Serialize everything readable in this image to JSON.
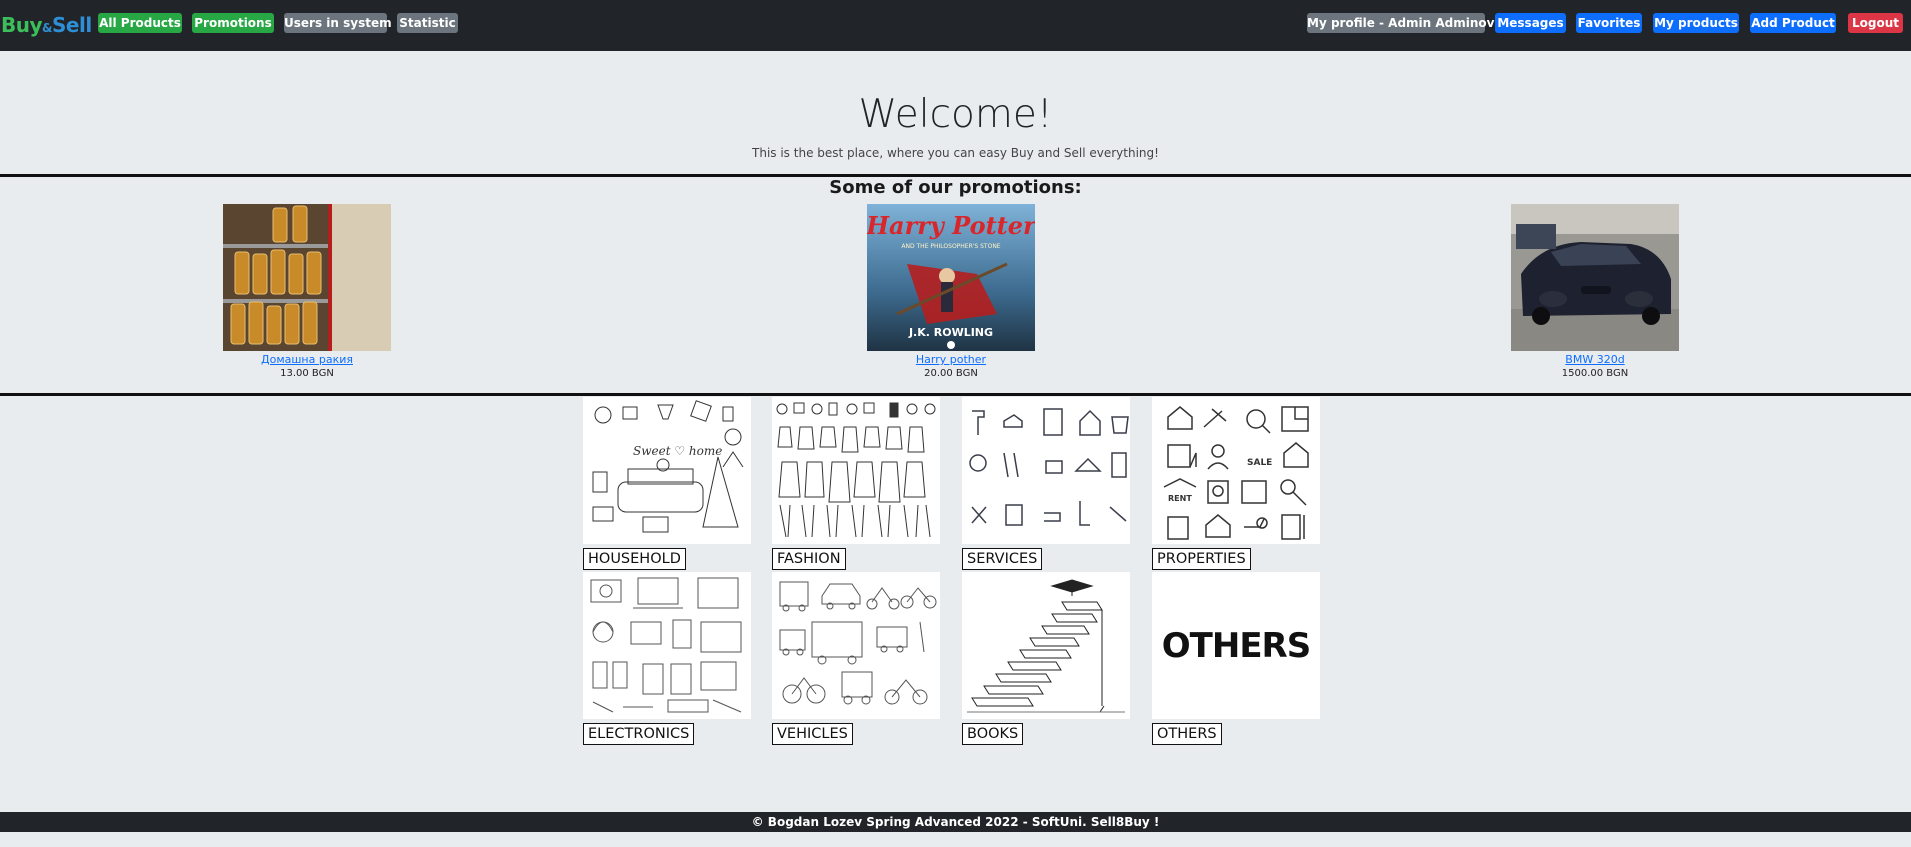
{
  "brand": {
    "part1": "Buy",
    "amp": "&",
    "part2": "Sell"
  },
  "nav": {
    "all_products": "All Products",
    "promotions": "Promotions",
    "users": "Users in system",
    "statistic": "Statistic",
    "profile": "My profile - Admin Adminov",
    "messages": "Messages",
    "favorites": "Favorites",
    "my_products": "My products",
    "add_product": "Add Product",
    "logout": "Logout"
  },
  "hero": {
    "title": "Welcome!",
    "tagline": "This is the best place, where you can easy Buy and Sell everything!"
  },
  "promotions": {
    "heading": "Some of our promotions:",
    "items": [
      {
        "name": "Домашна ракия",
        "price": "13.00 BGN"
      },
      {
        "name": "Harry pother",
        "price": "20.00 BGN"
      },
      {
        "name": "BMW 320d",
        "price": "1500.00 BGN"
      }
    ],
    "book_cover": {
      "title1": "Harry Potter",
      "subtitle": "AND THE PHILOSOPHER'S STONE",
      "author": "J.K. ROWLING"
    }
  },
  "categories": [
    {
      "label": "HOUSEHOLD"
    },
    {
      "label": "FASHION"
    },
    {
      "label": "SERVICES"
    },
    {
      "label": "PROPERTIES"
    },
    {
      "label": "ELECTRONICS"
    },
    {
      "label": "VEHICLES"
    },
    {
      "label": "BOOKS"
    },
    {
      "label": "OTHERS",
      "image_text": "OTHERS"
    }
  ],
  "household_image_text": "Sweet ♡ home",
  "footer": {
    "text": "© Bogdan Lozev Spring Advanced 2022 - SoftUni. Sell8Buy !"
  },
  "colors": {
    "navbar": "#212529",
    "green": "#28a745",
    "gray": "#6c757d",
    "blue": "#0d6efd",
    "red": "#dc3545",
    "background": "#e9ecef"
  }
}
